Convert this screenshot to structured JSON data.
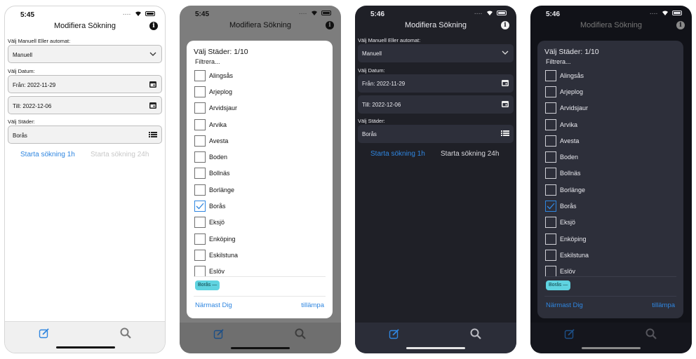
{
  "time": [
    "5:45",
    "5:45",
    "5:46",
    "5:46"
  ],
  "nav_title": "Modifiera Sökning",
  "mode_label": "Välj Manuell Eller automat:",
  "mode_value": "Manuell",
  "date_label": "Välj Datum:",
  "from_value": "Från: 2022-11-29",
  "to_value": "Till: 2022-12-06",
  "city_label": "Välj Städer:",
  "city_value": "Borås",
  "start_1h": "Starta sökning 1h",
  "start_24h": "Starta sökning 24h",
  "picker": {
    "title": "Välj Städer: 1/10",
    "filter": "Filtrera...",
    "cities": [
      "Alingsås",
      "Arjeplog",
      "Arvidsjaur",
      "Arvika",
      "Avesta",
      "Boden",
      "Bollnäs",
      "Borlänge",
      "Borås",
      "Eksjö",
      "Enköping",
      "Eskilstuna",
      "Eslöv"
    ],
    "checked_index": 8,
    "chip": "Borås —",
    "nearest": "Närmast Dig",
    "apply": "tillämpa"
  },
  "colors": {
    "accent": "#2f86e0",
    "chip": "#5fd3e0",
    "dark_bg": "#1f2027",
    "dark_field": "#2d2f3a"
  },
  "icons": [
    "info-icon",
    "chevron-down-icon",
    "calendar-icon",
    "list-icon",
    "compose-icon",
    "search-icon",
    "checkmark-icon"
  ]
}
